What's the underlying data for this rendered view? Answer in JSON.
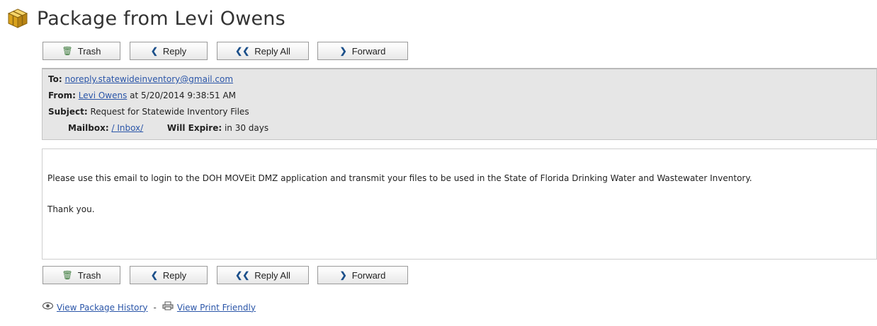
{
  "page": {
    "title": "Package from Levi Owens",
    "title_icon": "package-box-icon"
  },
  "toolbar": {
    "trash_label": "Trash",
    "reply_label": "Reply",
    "reply_all_label": "Reply All",
    "forward_label": "Forward"
  },
  "message": {
    "to_label": "To:",
    "to_value": "noreply.statewideinventory@gmail.com",
    "from_label": "From:",
    "from_name": "Levi Owens",
    "from_suffix": " at 5/20/2014 9:38:51 AM",
    "subject_label": "Subject:",
    "subject_value": " Request for Statewide Inventory Files",
    "mailbox_label": "Mailbox:",
    "mailbox_value": "/ Inbox/",
    "expire_label": "Will Expire:",
    "expire_value": " in 30 days",
    "body_paragraph": "Please use this email to login to the DOH MOVEit DMZ application and transmit your files to be used in the State of Florida Drinking Water and Wastewater Inventory.",
    "body_signoff": "Thank you."
  },
  "footer": {
    "history_link": "View Package History",
    "separator": "-",
    "print_link": "View Print Friendly"
  },
  "colors": {
    "link": "#2a55a8",
    "header_bg": "#e6e6e6",
    "icon_gold": "#d9a21b"
  }
}
